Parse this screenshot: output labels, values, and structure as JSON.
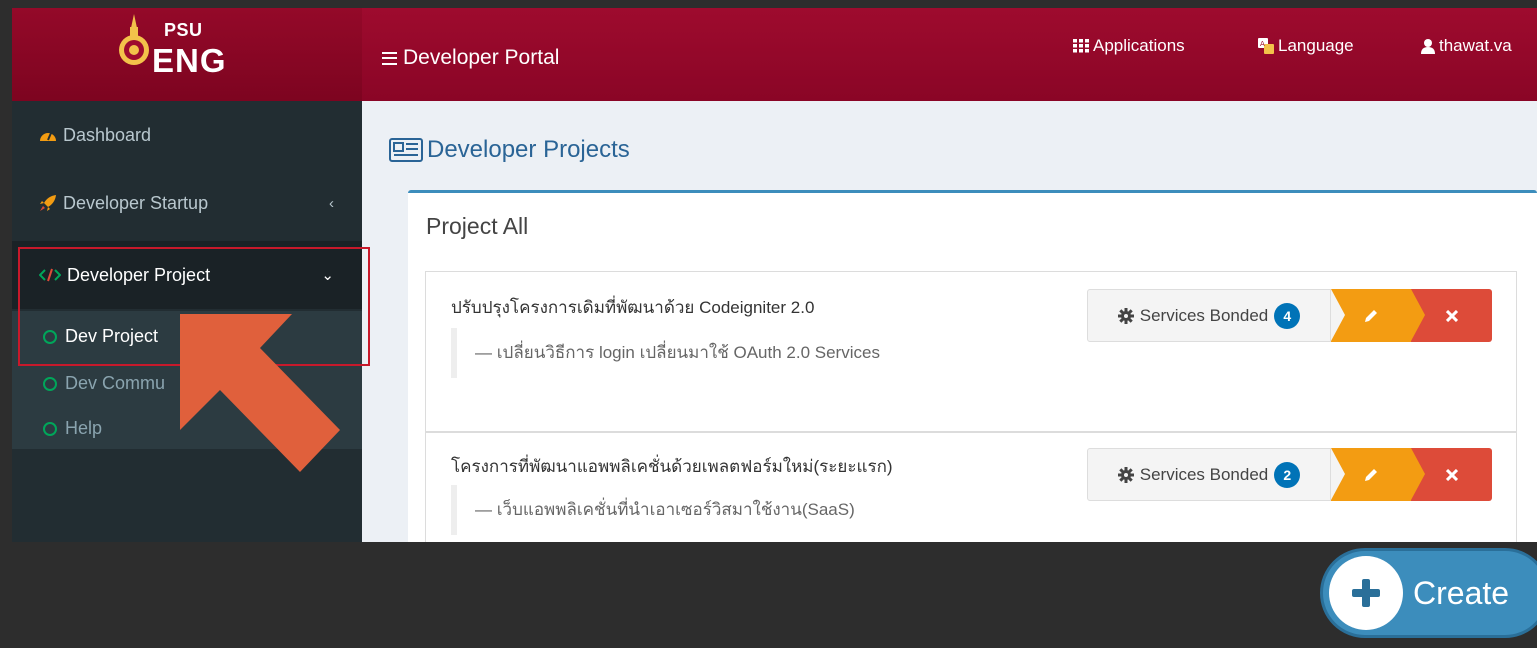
{
  "header": {
    "logo_top": "PSU",
    "logo_bottom": "ENG",
    "portal_title": "Developer Portal",
    "nav": {
      "applications": "Applications",
      "language": "Language",
      "user": "thawat.va"
    }
  },
  "sidebar": {
    "items": [
      {
        "label": "Dashboard",
        "icon": "dashboard-icon"
      },
      {
        "label": "Developer Startup",
        "icon": "rocket-icon"
      },
      {
        "label": "Developer Project",
        "icon": "code-icon"
      }
    ],
    "submenu": [
      {
        "label": "Dev Project"
      },
      {
        "label": "Dev Commu"
      },
      {
        "label": "Help"
      }
    ]
  },
  "main": {
    "page_title": "Developer Projects",
    "box_title": "Project All",
    "projects": [
      {
        "name": "ปรับปรุงโครงการเดิมที่พัฒนาด้วย Codeigniter 2.0",
        "description": "— เปลี่ยนวิธีการ login เปลี่ยนมาใช้ OAuth 2.0 Services",
        "services_label": "Services Bonded",
        "services_count": "4"
      },
      {
        "name": "โครงการที่พัฒนาแอพพลิเคชั่นด้วยเพลตฟอร์มใหม่(ระยะแรก)",
        "description": "— เว็บแอพพลิเคชั่นที่นำเอาเซอร์วิสมาใช้งาน(SaaS)",
        "services_label": "Services Bonded",
        "services_count": "2"
      }
    ]
  },
  "create_button": {
    "label": "Create"
  },
  "colors": {
    "header": "#9e0b2e",
    "sidebar": "#222d32",
    "primary": "#3c8dbc",
    "warning": "#f39c12",
    "danger": "#dd4b39",
    "highlight": "#c8192b",
    "arrow": "#e0603c"
  }
}
